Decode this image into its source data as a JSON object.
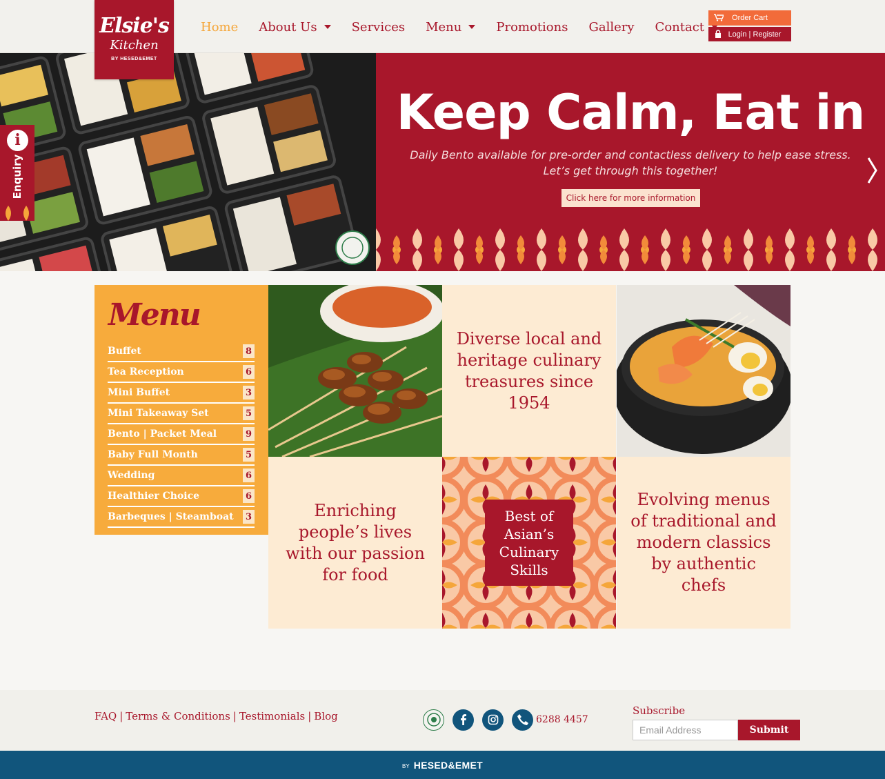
{
  "brand": {
    "logo_line1": "Elsie's",
    "logo_line2": "Kitchen",
    "logo_line3": "BY HESED&EMET",
    "primary_color": "#a8172b",
    "accent_color": "#f5a63a"
  },
  "nav": {
    "items": [
      {
        "label": "Home",
        "active": true,
        "dropdown": false
      },
      {
        "label": "About Us",
        "active": false,
        "dropdown": true
      },
      {
        "label": "Services",
        "active": false,
        "dropdown": false
      },
      {
        "label": "Menu",
        "active": false,
        "dropdown": true
      },
      {
        "label": "Promotions",
        "active": false,
        "dropdown": false
      },
      {
        "label": "Gallery",
        "active": false,
        "dropdown": false
      },
      {
        "label": "Contact",
        "active": false,
        "dropdown": true
      }
    ],
    "cart_label": "Order Cart",
    "login_label": "Login | Register"
  },
  "hero": {
    "title": "Keep Calm, Eat in",
    "subtitle_line1": "Daily Bento available for pre-order and contactless delivery to help ease stress.",
    "subtitle_line2": "Let’s get through this together!",
    "button_label": "Click here for more information"
  },
  "enquiry": {
    "label": "Enquiry",
    "icon_glyph": "i"
  },
  "menu_panel": {
    "title": "Menu",
    "items": [
      {
        "name": "Buffet",
        "count": "8"
      },
      {
        "name": "Tea Reception",
        "count": "6"
      },
      {
        "name": "Mini Buffet",
        "count": "3"
      },
      {
        "name": "Mini Takeaway Set",
        "count": "5"
      },
      {
        "name": "Bento | Packet Meal",
        "count": "9"
      },
      {
        "name": "Baby Full Month",
        "count": "5"
      },
      {
        "name": "Wedding",
        "count": "6"
      },
      {
        "name": "Healthier Choice",
        "count": "6"
      },
      {
        "name": "Barbeques | Steamboat",
        "count": "3"
      }
    ]
  },
  "tiles": {
    "heritage": "Diverse local and heritage culinary treasures since 1954",
    "passion": "Enriching people’s lives with our passion for food",
    "best": "Best of Asian’s Culinary Skills",
    "evolving": "Evolving menus of traditional and modern classics by authentic chefs"
  },
  "footer": {
    "links": [
      "FAQ",
      "Terms & Conditions",
      "Testimonials",
      "Blog"
    ],
    "phone": "6288 4457",
    "subscribe_label": "Subscribe",
    "email_placeholder": "Email Address",
    "submit_label": "Submit",
    "by_label": "BY",
    "company": "HESED&EMET"
  }
}
